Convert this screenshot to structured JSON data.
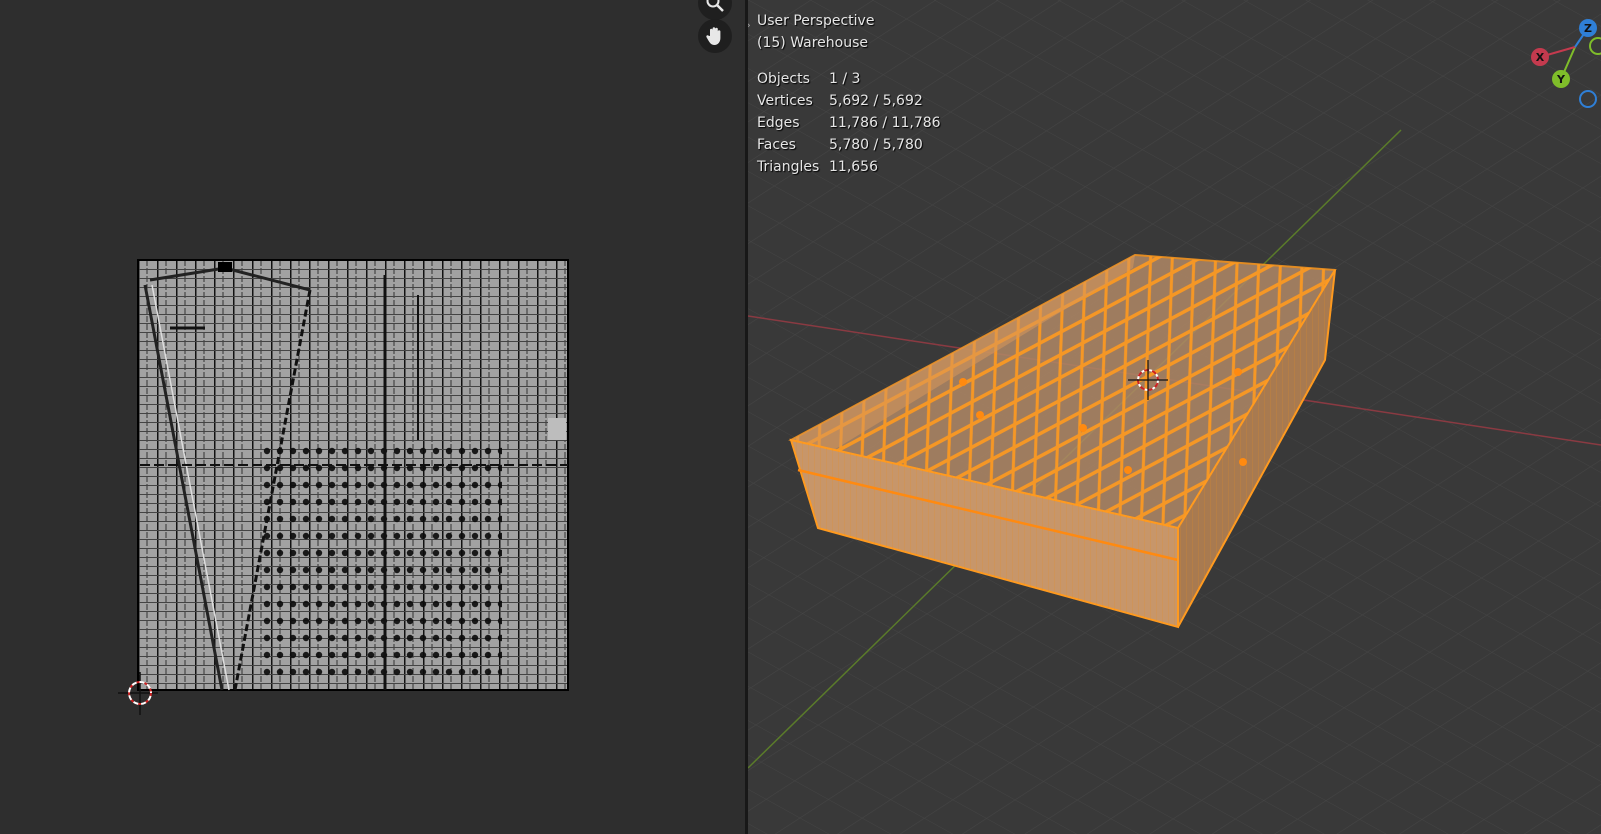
{
  "viewport": {
    "view_name": "User Perspective",
    "collection": "(15) Warehouse",
    "stats": [
      {
        "label": "Objects",
        "value": "1 / 3"
      },
      {
        "label": "Vertices",
        "value": "5,692 / 5,692"
      },
      {
        "label": "Edges",
        "value": "11,786 / 11,786"
      },
      {
        "label": "Faces",
        "value": "5,780 / 5,780"
      },
      {
        "label": "Triangles",
        "value": "11,656"
      }
    ]
  },
  "gizmo": {
    "x_label": "X",
    "y_label": "Y",
    "z_label": "Z"
  },
  "colors": {
    "x_axis": "#c43a4e",
    "y_axis": "#7fbd2a",
    "z_axis": "#2f7fd6",
    "selection_orange": "#ff9a1f",
    "uv_fill": "#9c9c9c"
  },
  "icons": {
    "zoom_tool": "magnifier-icon",
    "pan_tool": "hand-icon",
    "cursor": "3d-cursor-icon"
  }
}
